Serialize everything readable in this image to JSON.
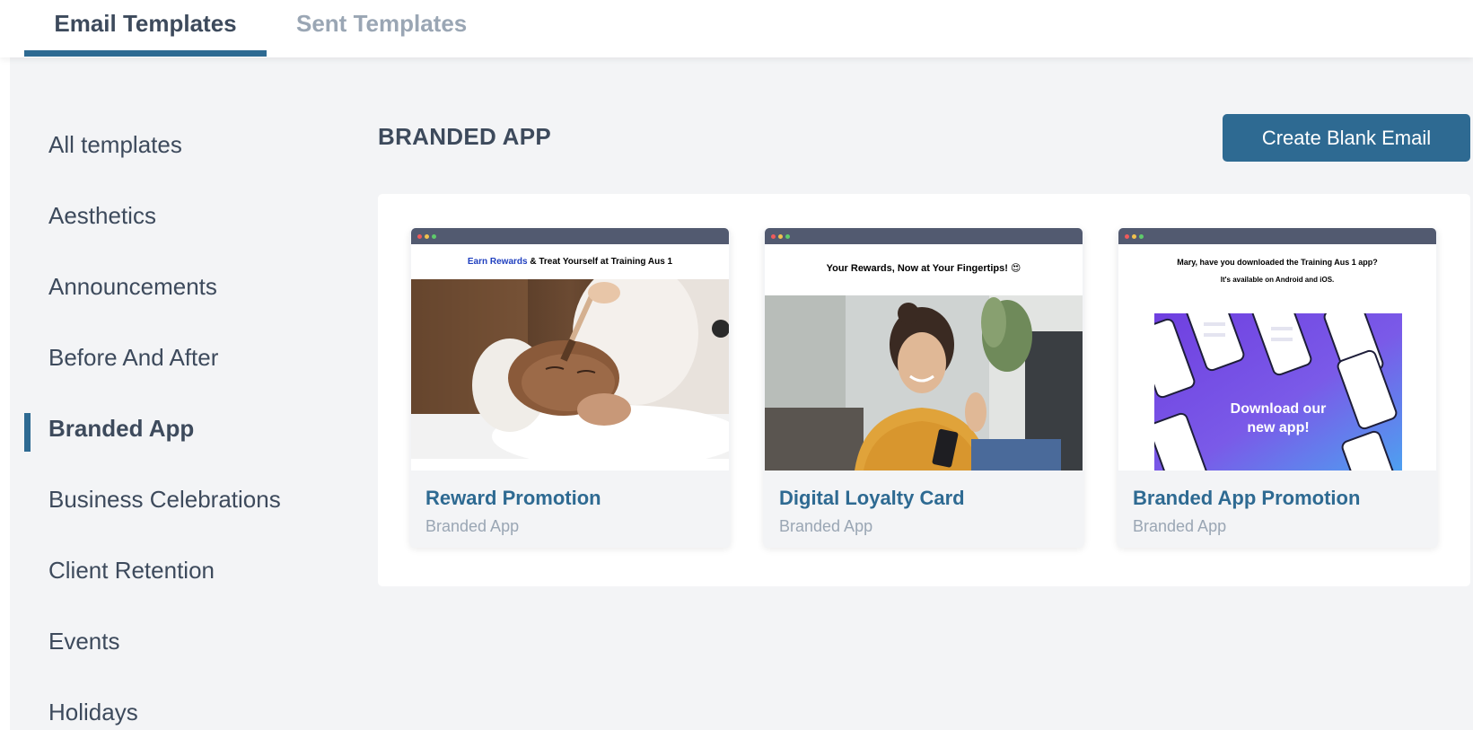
{
  "tabs": {
    "active": "Email Templates",
    "inactive": "Sent Templates"
  },
  "sidebar": {
    "items": [
      {
        "label": "All templates"
      },
      {
        "label": "Aesthetics"
      },
      {
        "label": "Announcements"
      },
      {
        "label": "Before And After"
      },
      {
        "label": "Branded App"
      },
      {
        "label": "Business Celebrations"
      },
      {
        "label": "Client Retention"
      },
      {
        "label": "Events"
      },
      {
        "label": "Holidays"
      }
    ],
    "active_label": "Branded App"
  },
  "main": {
    "section_title": "BRANDED APP",
    "create_button": "Create Blank Email"
  },
  "cards": [
    {
      "title": "Reward Promotion",
      "category": "Branded App",
      "preview_accent": "Earn Rewards",
      "preview_headline": " & Treat Yourself at Training Aus 1"
    },
    {
      "title": "Digital Loyalty Card",
      "category": "Branded App",
      "preview_headline": "Your Rewards, Now at Your Fingertips! 😍"
    },
    {
      "title": "Branded App Promotion",
      "category": "Branded App",
      "preview_headline": "Mary, have you downloaded the Training Aus 1 app?",
      "preview_subline": "It's available on Android and iOS.",
      "preview_banner_line1": "Download our",
      "preview_banner_line2": "new app!"
    }
  ],
  "colors": {
    "accent": "#2e6a92",
    "text": "#3d4a5c",
    "muted": "#9aa6b4",
    "background": "#f3f4f6"
  }
}
